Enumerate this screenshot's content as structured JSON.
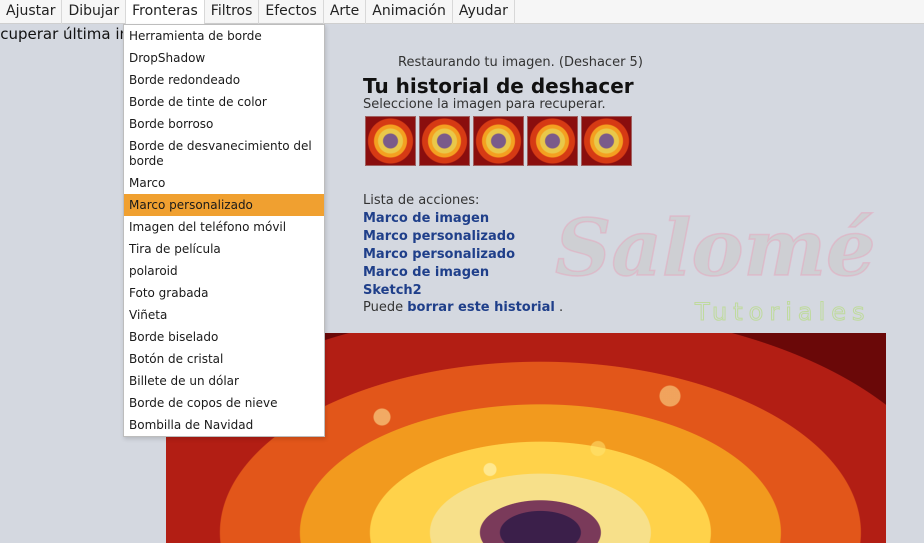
{
  "menubar": {
    "items": [
      "Ajustar",
      "Dibujar",
      "Fronteras",
      "Filtros",
      "Efectos",
      "Arte",
      "Animación",
      "Ayudar"
    ]
  },
  "recover_text": "ecuperar última im",
  "dropdown": {
    "items": [
      "Herramienta de borde",
      "DropShadow",
      "Borde redondeado",
      "Borde de tinte de color",
      "Borde borroso",
      "Borde de desvanecimiento del borde",
      "Marco",
      "Marco personalizado",
      "Imagen del teléfono móvil",
      "Tira de película",
      "polaroid",
      "Foto grabada",
      "Viñeta",
      "Borde biselado",
      "Botón de cristal",
      "Billete de un dólar",
      "Borde de copos de nieve",
      "Bombilla de Navidad"
    ],
    "active": "Marco personalizado"
  },
  "status": "Restaurando tu imagen. (Deshacer 5)",
  "history": {
    "title": "Tu historial de deshacer",
    "subtitle": "Seleccione la imagen para recuperar.",
    "thumb_count": 5
  },
  "actions": {
    "label": "Lista de acciones:",
    "items": [
      "Marco de imagen",
      "Marco personalizado",
      "Marco personalizado",
      "Marco de imagen",
      "Sketch2"
    ],
    "clear_prefix": "Puede",
    "clear_link": "borrar este historial",
    "clear_suffix": "."
  },
  "watermark": {
    "line1": "Salomé",
    "line2": "Tutoriales"
  },
  "colors": {
    "menu_active": "#f0a030",
    "link": "#1f3f8a",
    "background": "#d4d8e0"
  }
}
